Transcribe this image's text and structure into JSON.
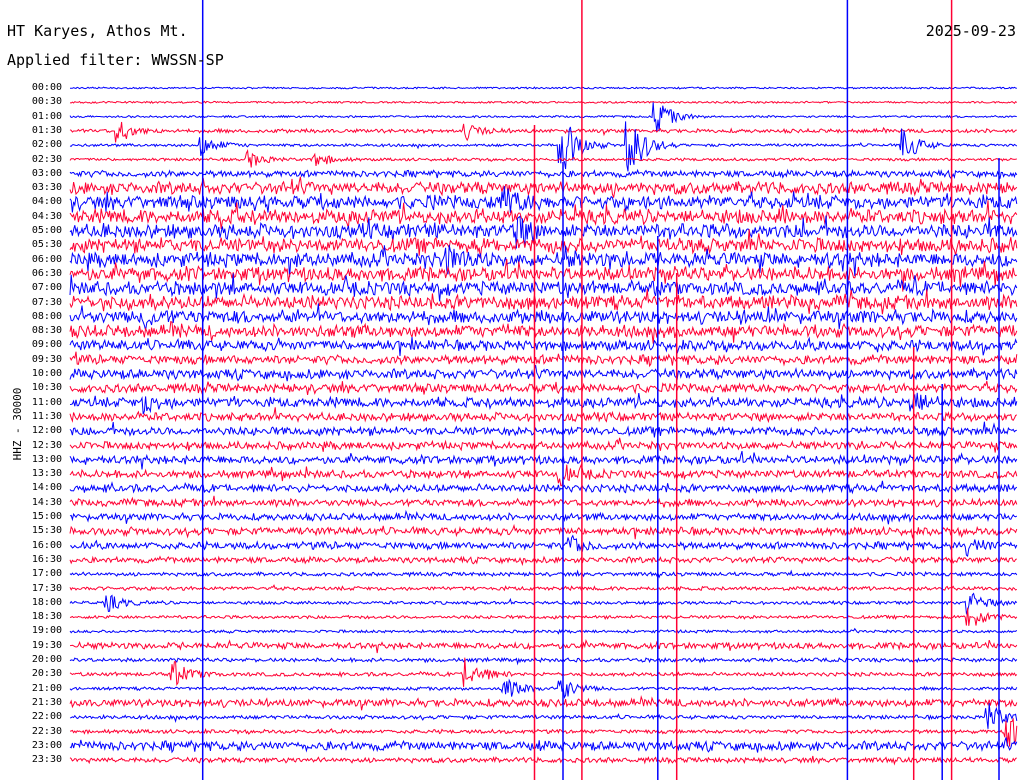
{
  "header": {
    "station": "HT Karyes, Athos Mt.",
    "date": "2025-09-23",
    "filter": "Applied filter: WWSSN-SP"
  },
  "axis": {
    "channel_label": "HHZ - 30000"
  },
  "colors": {
    "trace_a": "#0000ff",
    "trace_b": "#ff0033",
    "background": "#ffffff",
    "text": "#000000"
  },
  "chart_data": {
    "type": "line",
    "title": "HT Karyes, Athos Mt.",
    "subtitle": "Applied filter: WWSSN-SP",
    "ylabel": "HHZ - 30000",
    "row_labels": [
      "00:00",
      "00:30",
      "01:00",
      "01:30",
      "02:00",
      "02:30",
      "03:00",
      "03:30",
      "04:00",
      "04:30",
      "05:00",
      "05:30",
      "06:00",
      "06:30",
      "07:00",
      "07:30",
      "08:00",
      "08:30",
      "09:00",
      "09:30",
      "10:00",
      "10:30",
      "11:00",
      "11:30",
      "12:00",
      "12:30",
      "13:00",
      "13:30",
      "14:00",
      "14:30",
      "15:00",
      "15:30",
      "16:00",
      "16:30",
      "17:00",
      "17:30",
      "18:00",
      "18:30",
      "19:00",
      "19:30",
      "20:00",
      "20:30",
      "21:00",
      "21:30",
      "22:00",
      "22:30",
      "23:00",
      "23:30"
    ],
    "row_colors": [
      "trace_a",
      "trace_b"
    ],
    "noise_level": [
      0.04,
      0.05,
      0.06,
      0.2,
      0.12,
      0.12,
      0.4,
      0.85,
      0.95,
      1.0,
      1.0,
      1.0,
      1.0,
      1.0,
      0.95,
      0.95,
      0.9,
      0.85,
      0.7,
      0.6,
      0.65,
      0.6,
      0.65,
      0.55,
      0.55,
      0.5,
      0.55,
      0.5,
      0.5,
      0.45,
      0.45,
      0.5,
      0.45,
      0.35,
      0.2,
      0.2,
      0.15,
      0.15,
      0.12,
      0.4,
      0.2,
      0.2,
      0.15,
      0.5,
      0.2,
      0.2,
      0.6,
      0.3
    ],
    "events": [
      {
        "row": 3,
        "pos": 0.05,
        "amp": 3.0
      },
      {
        "row": 3,
        "pos": 0.42,
        "amp": 1.8
      },
      {
        "row": 4,
        "pos": 0.14,
        "amp": 2.5
      },
      {
        "row": 4,
        "pos": 0.52,
        "amp": 8.0
      },
      {
        "row": 4,
        "pos": 0.59,
        "amp": 9.0
      },
      {
        "row": 4,
        "pos": 0.88,
        "amp": 4.0
      },
      {
        "row": 5,
        "pos": 0.19,
        "amp": 2.0
      },
      {
        "row": 5,
        "pos": 0.26,
        "amp": 1.8
      },
      {
        "row": 2,
        "pos": 0.62,
        "amp": 4.0
      },
      {
        "row": 8,
        "pos": 0.46,
        "amp": 3.0
      },
      {
        "row": 10,
        "pos": 0.47,
        "amp": 3.5
      },
      {
        "row": 12,
        "pos": 0.4,
        "amp": 3.0
      },
      {
        "row": 16,
        "pos": 0.08,
        "amp": 2.0
      },
      {
        "row": 22,
        "pos": 0.08,
        "amp": 2.0
      },
      {
        "row": 22,
        "pos": 0.89,
        "amp": 2.5
      },
      {
        "row": 27,
        "pos": 0.52,
        "amp": 2.0
      },
      {
        "row": 32,
        "pos": 0.53,
        "amp": 1.8
      },
      {
        "row": 32,
        "pos": 0.95,
        "amp": 2.0
      },
      {
        "row": 36,
        "pos": 0.04,
        "amp": 2.0
      },
      {
        "row": 36,
        "pos": 0.95,
        "amp": 2.5
      },
      {
        "row": 37,
        "pos": 0.95,
        "amp": 3.0
      },
      {
        "row": 41,
        "pos": 0.11,
        "amp": 3.0
      },
      {
        "row": 41,
        "pos": 0.42,
        "amp": 4.0
      },
      {
        "row": 42,
        "pos": 0.46,
        "amp": 2.5
      },
      {
        "row": 42,
        "pos": 0.52,
        "amp": 2.5
      },
      {
        "row": 44,
        "pos": 0.97,
        "amp": 3.5
      },
      {
        "row": 45,
        "pos": 0.99,
        "amp": 4.0
      }
    ],
    "vertical_spikes": [
      0.14,
      0.49,
      0.52,
      0.54,
      0.62,
      0.64,
      0.82,
      0.89,
      0.92,
      0.93,
      0.98
    ],
    "grid": false,
    "legend": "none"
  }
}
